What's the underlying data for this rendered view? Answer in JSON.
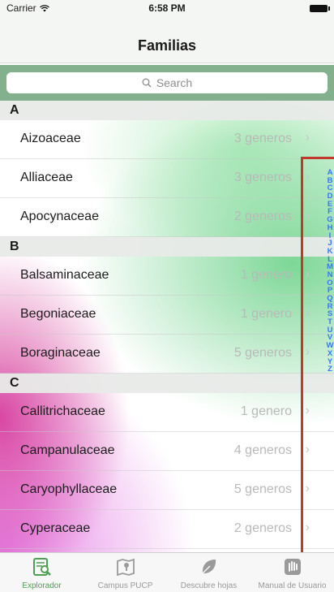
{
  "status_bar": {
    "carrier": "Carrier",
    "time": "6:58 PM"
  },
  "nav": {
    "title": "Familias"
  },
  "search": {
    "placeholder": "Search"
  },
  "sections": [
    {
      "letter": "A",
      "rows": [
        {
          "name": "Aizoaceae",
          "count": "3 generos"
        },
        {
          "name": "Alliaceae",
          "count": "3 generos"
        },
        {
          "name": "Apocynaceae",
          "count": "2 generos"
        }
      ]
    },
    {
      "letter": "B",
      "rows": [
        {
          "name": "Balsaminaceae",
          "count": "1 genero"
        },
        {
          "name": "Begoniaceae",
          "count": "1 genero"
        },
        {
          "name": "Boraginaceae",
          "count": "5 generos"
        }
      ]
    },
    {
      "letter": "C",
      "rows": [
        {
          "name": "Callitrichaceae",
          "count": "1 genero"
        },
        {
          "name": "Campanulaceae",
          "count": "4 generos"
        },
        {
          "name": "Caryophyllaceae",
          "count": "5 generos"
        },
        {
          "name": "Cyperaceae",
          "count": "2 generos"
        }
      ]
    }
  ],
  "index_letters": [
    "A",
    "B",
    "C",
    "D",
    "E",
    "F",
    "G",
    "H",
    "I",
    "J",
    "K",
    "L",
    "M",
    "N",
    "O",
    "P",
    "Q",
    "R",
    "S",
    "T",
    "U",
    "V",
    "W",
    "X",
    "Y",
    "Z"
  ],
  "tabs": [
    {
      "label": "Explorador",
      "icon": "explorer-icon",
      "active": true
    },
    {
      "label": "Campus PUCP",
      "icon": "map-icon",
      "active": false
    },
    {
      "label": "Descubre hojas",
      "icon": "leaf-icon",
      "active": false
    },
    {
      "label": "Manual de Usuario",
      "icon": "hand-icon",
      "active": false
    }
  ],
  "colors": {
    "accent": "#4e9e55",
    "search_bar_bg": "#83b08d",
    "index_letters": "#3478f6",
    "highlight_border": "#c0392b"
  }
}
